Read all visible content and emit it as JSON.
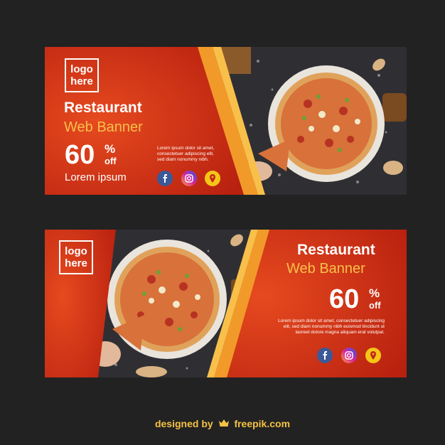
{
  "banners": [
    {
      "logo_line1": "logo",
      "logo_line2": "here",
      "title": "Restaurant",
      "subtitle": "Web Banner",
      "discount_number": "60",
      "discount_percent": "%",
      "discount_off": "off",
      "tagline": "Lorem ipsum",
      "desc_line1": "Lorem ipsum dolor sit amet,",
      "desc_line2": "consectetuer adipiscing elit,",
      "desc_line3": "sed diam nonummy nibh."
    },
    {
      "logo_line1": "logo",
      "logo_line2": "here",
      "title": "Restaurant",
      "subtitle": "Web Banner",
      "discount_number": "60",
      "discount_percent": "%",
      "discount_off": "off",
      "desc_line1": "Lorem ipsum dolor sit amet, consectetuer adipiscing",
      "desc_line2": "elit, sed diam nonummy nibh euismod tincidunt ut",
      "desc_line3": "laoreet dolore magna aliquam erat volutpat."
    }
  ],
  "social_icons": [
    "facebook-icon",
    "instagram-icon",
    "location-pin-icon"
  ],
  "footer": {
    "designed_by": "designed by",
    "brand": "freepik.com"
  },
  "colors": {
    "background": "#222222",
    "banner_red": "#d23a1a",
    "accent_yellow": "#f8c04a",
    "facebook": "#3b5998",
    "location": "#f5c518"
  }
}
